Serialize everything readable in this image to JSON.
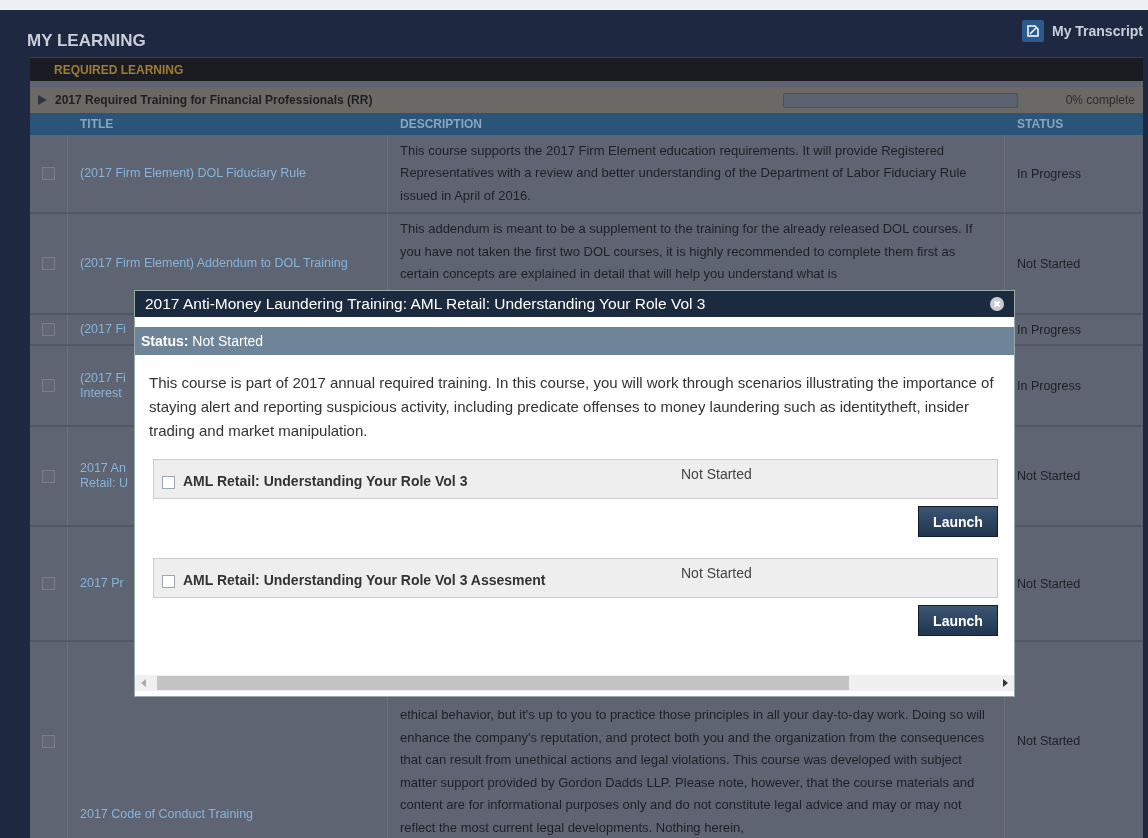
{
  "header": {
    "title": "MY LEARNING",
    "transcript_link": "My Transcript"
  },
  "section": {
    "title": "REQUIRED LEARNING"
  },
  "curriculum": {
    "title": "2017 Required Training for Financial Professionals (RR)",
    "expanded": false,
    "level": 0,
    "progress_text": "0% complete"
  },
  "table": {
    "columns": [
      "TITLE",
      "DESCRIPTION",
      "STATUS"
    ],
    "rows": [
      {
        "title_lines": [
          "(2017 Firm Element) DOL Fiduciary Rule"
        ],
        "description": "This course supports the 2017 Firm Element education requirements. It will provide Registered Representatives with a review and better understanding of the Department of Labor Fiduciary Rule issued in April of 2016.",
        "status": "In Progress",
        "checked": false
      },
      {
        "title_lines": [
          "(2017 Firm Element) Addendum to DOL Training"
        ],
        "description": "This addendum is meant to be a supplement to the training for the already released DOL courses. If you have not taken the first two DOL courses, it is highly recommended to complete them first as certain concepts are explained in detail that will help you understand what is",
        "status": "Not Started",
        "checked": false
      },
      {
        "title_lines": [
          "(2017 Fi"
        ],
        "status": "In Progress",
        "checked": false
      },
      {
        "title_lines": [
          "(2017 Fi",
          "Interest"
        ],
        "status": "In Progress",
        "checked": false
      },
      {
        "title_lines": [
          "2017 An",
          "Retail: U"
        ],
        "status": "Not Started",
        "checked": false
      },
      {
        "title_lines": [
          "2017 Pr"
        ],
        "status": "Not Started",
        "checked": false
      },
      {
        "title_lines": [
          "2017 Code of Conduct Training"
        ],
        "description": "ethical behavior, but it's up to you to practice those principles in all your day-to-day work. Doing so will enhance the company's reputation, and protect both you and the organization from the consequences that can result from unethical actions and legal violations. This course was developed with subject matter support provided by Gordon Dadds LLP. Please note, however, that the course materials and content are for informational purposes only and do not constitute legal advice and may or may not reflect the most current legal developments. Nothing herein,",
        "status": "Not Started",
        "checked": false
      }
    ]
  },
  "modal": {
    "title": "2017 Anti-Money Laundering Training: AML Retail: Understanding Your Role Vol 3",
    "status_label": "Status:",
    "status": "Not Started",
    "description": "This course is part of 2017 annual required training. In this course, you will work through scenarios illustrating the importance of staying alert and reporting suspicious activity, including predicate offenses to money laundering such as identitytheft, insider trading and market manipulation.",
    "items": [
      {
        "title": "AML Retail: Understanding Your Role Vol 3",
        "status": "Not Started",
        "checked": false,
        "button": "Launch"
      },
      {
        "title": "AML Retail: Understanding Your Role Vol 3 Assesment",
        "status": "Not Started",
        "checked": false,
        "button": "Launch"
      }
    ]
  }
}
